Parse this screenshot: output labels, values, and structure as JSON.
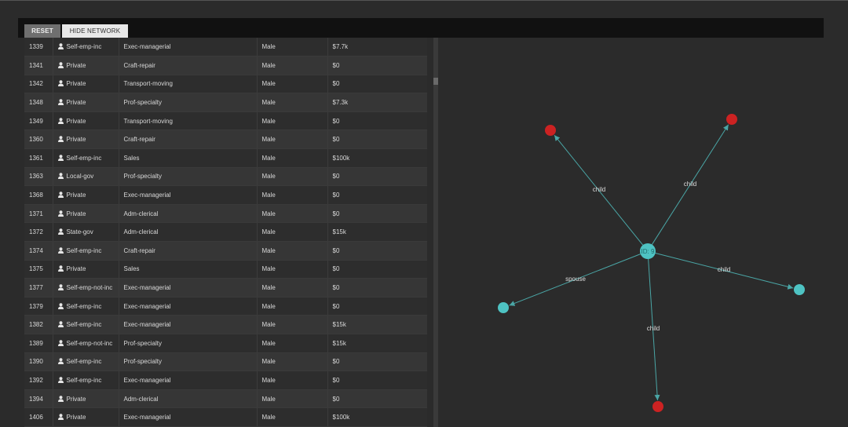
{
  "toolbar": {
    "reset_label": "RESET",
    "hide_network_label": "HIDE NETWORK"
  },
  "table": {
    "rows": [
      [
        "1339",
        "Self-emp-inc",
        "Exec-managerial",
        "Male",
        "$7.7k"
      ],
      [
        "1341",
        "Private",
        "Craft-repair",
        "Male",
        "$0"
      ],
      [
        "1342",
        "Private",
        "Transport-moving",
        "Male",
        "$0"
      ],
      [
        "1348",
        "Private",
        "Prof-specialty",
        "Male",
        "$7.3k"
      ],
      [
        "1349",
        "Private",
        "Transport-moving",
        "Male",
        "$0"
      ],
      [
        "1360",
        "Private",
        "Craft-repair",
        "Male",
        "$0"
      ],
      [
        "1361",
        "Self-emp-inc",
        "Sales",
        "Male",
        "$100k"
      ],
      [
        "1363",
        "Local-gov",
        "Prof-specialty",
        "Male",
        "$0"
      ],
      [
        "1368",
        "Private",
        "Exec-managerial",
        "Male",
        "$0"
      ],
      [
        "1371",
        "Private",
        "Adm-clerical",
        "Male",
        "$0"
      ],
      [
        "1372",
        "State-gov",
        "Adm-clerical",
        "Male",
        "$15k"
      ],
      [
        "1374",
        "Self-emp-inc",
        "Craft-repair",
        "Male",
        "$0"
      ],
      [
        "1375",
        "Private",
        "Sales",
        "Male",
        "$0"
      ],
      [
        "1377",
        "Self-emp-not-inc",
        "Exec-managerial",
        "Male",
        "$0"
      ],
      [
        "1379",
        "Self-emp-inc",
        "Exec-managerial",
        "Male",
        "$0"
      ],
      [
        "1382",
        "Self-emp-inc",
        "Exec-managerial",
        "Male",
        "$15k"
      ],
      [
        "1389",
        "Self-emp-not-inc",
        "Prof-specialty",
        "Male",
        "$15k"
      ],
      [
        "1390",
        "Self-emp-inc",
        "Prof-specialty",
        "Male",
        "$0"
      ],
      [
        "1392",
        "Self-emp-inc",
        "Exec-managerial",
        "Male",
        "$0"
      ],
      [
        "1394",
        "Private",
        "Adm-clerical",
        "Male",
        "$0"
      ],
      [
        "1406",
        "Private",
        "Exec-managerial",
        "Male",
        "$100k"
      ]
    ],
    "person_icon": "person-icon"
  },
  "network": {
    "center": {
      "label": "ID: 9",
      "color": "#4ec3c3"
    },
    "children": [
      {
        "relation": "child",
        "color": "#cc2222"
      },
      {
        "relation": "child",
        "color": "#cc2222"
      },
      {
        "relation": "child",
        "color": "#4ec3c3"
      },
      {
        "relation": "spouse",
        "color": "#4ec3c3"
      },
      {
        "relation": "child",
        "color": "#cc2222"
      }
    ],
    "edge_color": "#4aa6a6"
  }
}
